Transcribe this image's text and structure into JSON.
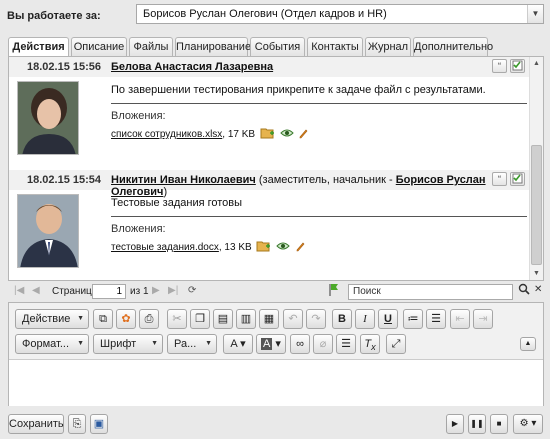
{
  "header": {
    "label": "Вы работаете за:",
    "user": "Борисов Руслан Олегович (Отдел кадров и HR)"
  },
  "tabs": [
    {
      "label": "Действия",
      "active": true
    },
    {
      "label": "Описание"
    },
    {
      "label": "Файлы"
    },
    {
      "label": "Планирование"
    },
    {
      "label": "События"
    },
    {
      "label": "Контакты"
    },
    {
      "label": "Журнал"
    },
    {
      "label": "Дополнительно"
    }
  ],
  "messages": [
    {
      "date": "18.02.15 15:56",
      "author": "Белова Анастасия Лазаревна",
      "author_extra_before": "",
      "author_link": "",
      "author_extra_after": "",
      "text": "По завершении тестирования прикрепите к задаче файл с результатами.",
      "attachments_label": "Вложения:",
      "file_name": "список сотрудников.xlsx",
      "file_size": ", 17 KB"
    },
    {
      "date": "18.02.15 15:54",
      "author": "Никитин Иван Николаевич",
      "author_extra_before": " (заместитель, начальник - ",
      "author_link": "Борисов Руслан Олегович",
      "author_extra_after": ")",
      "text": "Тестовые задания готовы",
      "attachments_label": "Вложения:",
      "file_name": "тестовые задания.docx",
      "file_size": ", 13 KB"
    }
  ],
  "pager": {
    "page_label": "Страница",
    "page_value": "1",
    "of_label": "из 1",
    "search_placeholder": "Поиск"
  },
  "editor": {
    "action_label": "Действие",
    "format_label": "Формат...",
    "font_label": "Шрифт",
    "size_label": "Ра...",
    "bold": "B",
    "italic": "I",
    "underline": "U"
  },
  "footer": {
    "save_label": "Сохранить"
  },
  "colors": {
    "accent_green": "#3a9a2a",
    "accent_orange": "#e08a1e",
    "header_bg": "#f1f1f1"
  }
}
